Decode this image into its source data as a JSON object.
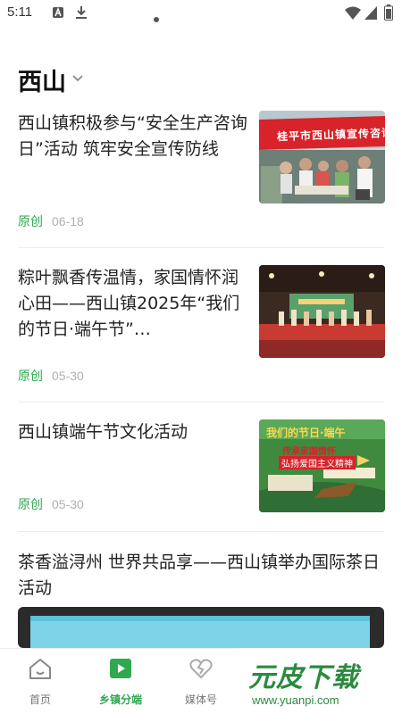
{
  "status": {
    "time": "5:11"
  },
  "header": {
    "title": "西山"
  },
  "articles": [
    {
      "title": "西山镇积极参与“安全生产咨询日”活动 筑牢安全宣传防线",
      "tag": "原创",
      "date": "06-18",
      "banner": "桂平市西山镇宣传咨询"
    },
    {
      "title": "粽叶飘香传温情，家国情怀润心田——西山镇2025年“我们的节日·端午节”…",
      "tag": "原创",
      "date": "05-30"
    },
    {
      "title": "西山镇端午节文化活动",
      "tag": "原创",
      "date": "05-30",
      "poster_line1": "我们的节日·端午",
      "poster_line2": "传承家国情怀",
      "poster_line3": "弘扬爱国主义精神"
    },
    {
      "title": "茶香溢浔州 世界共品享——西山镇举办国际茶日活动"
    }
  ],
  "nav": {
    "items": [
      {
        "label": "首页",
        "icon": "home-icon"
      },
      {
        "label": "乡镇分端",
        "icon": "play-square-icon"
      },
      {
        "label": "媒体号",
        "icon": "heart-broken-icon"
      }
    ]
  },
  "watermark": {
    "logo": "元皮下载",
    "url": "www.yuanpi.com"
  },
  "colors": {
    "accent": "#2fa84f",
    "date": "#b0b0b0"
  }
}
